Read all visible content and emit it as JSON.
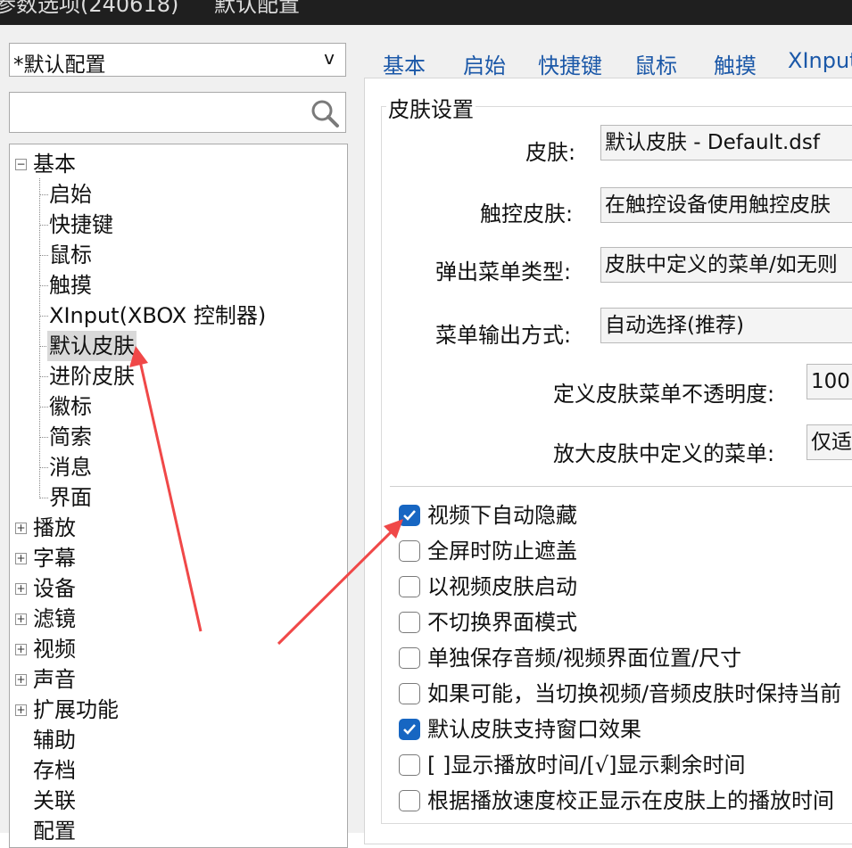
{
  "title_bar": {
    "left_text": "参数选项(240618)",
    "right_text": "默认配置"
  },
  "profile": {
    "selected": "*默认配置",
    "arrow": "v"
  },
  "search": {
    "placeholder": "",
    "icon": "search-icon"
  },
  "tree": {
    "root_expanded": {
      "label": "基本",
      "children": [
        "启始",
        "快捷键",
        "鼠标",
        "触摸",
        "XInput(XBOX 控制器)",
        "默认皮肤",
        "进阶皮肤",
        "徽标",
        "简索",
        "消息",
        "界面"
      ]
    },
    "selected": "默认皮肤",
    "collapsed": [
      "播放",
      "字幕",
      "设备",
      "滤镜",
      "视频",
      "声音",
      "扩展功能"
    ],
    "leaves": [
      "辅助",
      "存档",
      "关联",
      "配置"
    ]
  },
  "tabs": [
    "基本",
    "启始",
    "快捷键",
    "鼠标",
    "触摸",
    "XInput"
  ],
  "group": {
    "title": "皮肤设置",
    "fields": [
      {
        "label": "皮肤:",
        "value": "默认皮肤 - Default.dsf"
      },
      {
        "label": "触控皮肤:",
        "value": "在触控设备使用触控皮肤"
      },
      {
        "label": "弹出菜单类型:",
        "value": "皮肤中定义的菜单/如无则"
      },
      {
        "label": "菜单输出方式:",
        "value": "自动选择(推荐)"
      },
      {
        "label": "定义皮肤菜单不透明度:",
        "value": "100"
      },
      {
        "label": "放大皮肤中定义的菜单:",
        "value": "仅适"
      }
    ],
    "checkboxes": [
      {
        "label": "视频下自动隐藏",
        "checked": true
      },
      {
        "label": "全屏时防止遮盖",
        "checked": false
      },
      {
        "label": "以视频皮肤启动",
        "checked": false
      },
      {
        "label": "不切换界面模式",
        "checked": false
      },
      {
        "label": "单独保存音频/视频界面位置/尺寸",
        "checked": false
      },
      {
        "label": "如果可能，当切换视频/音频皮肤时保持当前",
        "checked": false
      },
      {
        "label": "默认皮肤支持窗口效果",
        "checked": true
      },
      {
        "label": "[ ]显示播放时间/[√]显示剩余时间",
        "checked": false
      },
      {
        "label": "根据播放速度校正显示在皮肤上的播放时间",
        "checked": false
      }
    ]
  },
  "colors": {
    "accent": "#1766c2",
    "tab_text": "#1b58a8",
    "annotation_arrow": "#f04848",
    "titlebar": "#1f1f1f"
  }
}
